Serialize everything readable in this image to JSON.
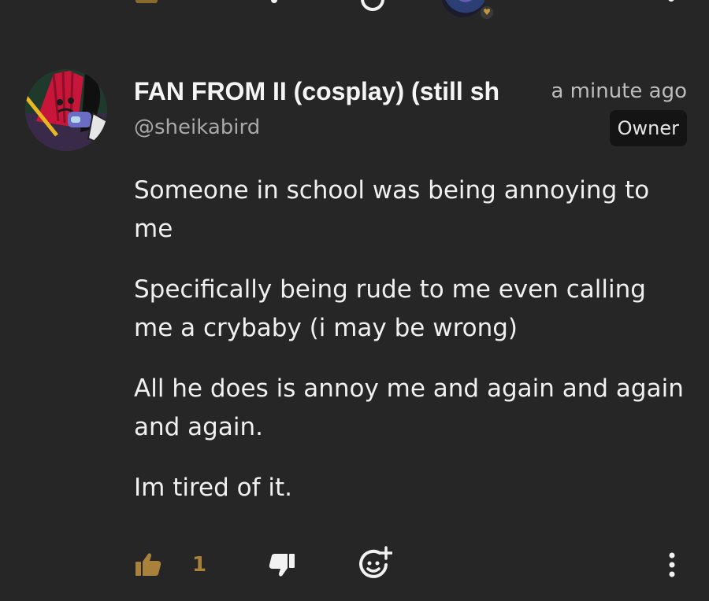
{
  "comment": {
    "author": {
      "display_name": "FAN FROM II (cosplay) (still sh",
      "handle": "@sheikabird",
      "avatar_icon": "character-avatar-icon"
    },
    "timestamp": "a minute ago",
    "role_badge": "Owner",
    "paragraphs": [
      "Someone in school was being annoying to me",
      "Specifically being rude to me even calling me a crybaby (i may be wrong)",
      "All he does is annoy me and again and again and again.",
      "Im tired of it."
    ],
    "actions": {
      "like_icon": "thumbs-up-icon",
      "like_count": "1",
      "dislike_icon": "thumbs-down-icon",
      "react_icon": "add-reaction-icon",
      "more_icon": "more-vertical-icon"
    }
  },
  "colors": {
    "background": "#262626",
    "accent": "#a8823a",
    "badge_background": "#141414"
  }
}
